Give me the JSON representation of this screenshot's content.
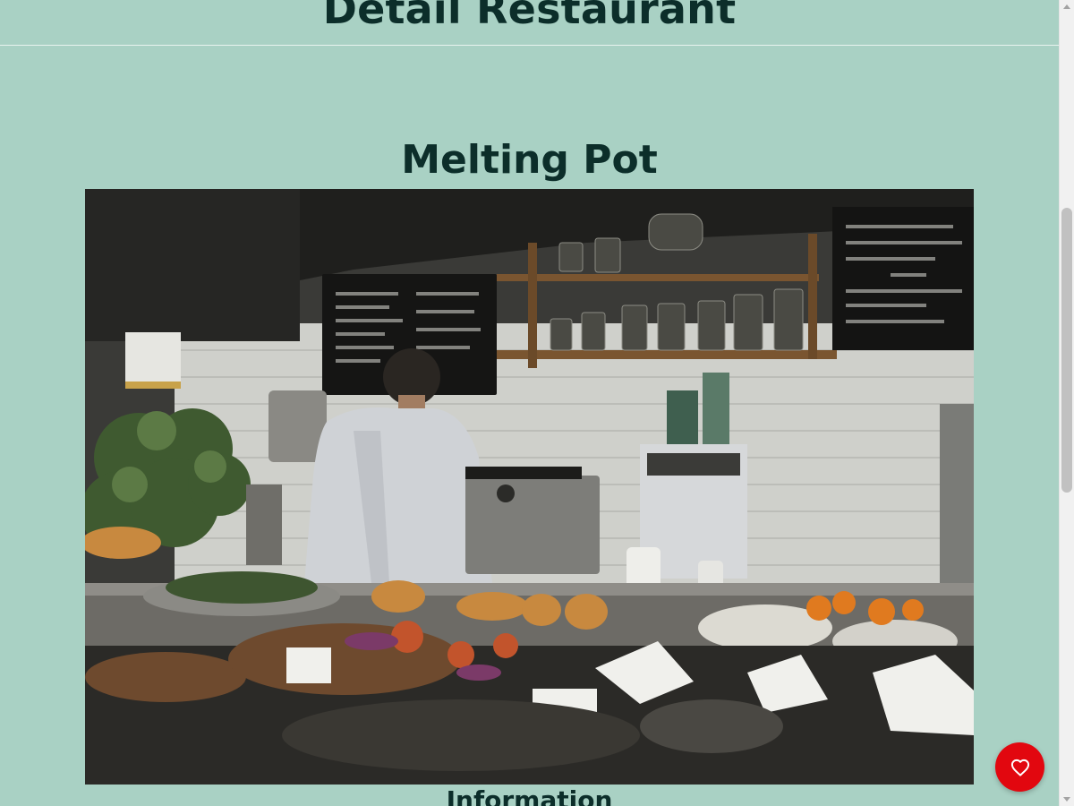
{
  "header": {
    "title": "Detail Restaurant"
  },
  "restaurant": {
    "name": "Melting Pot",
    "photo_icon": "restaurant-photo"
  },
  "sections": {
    "information_heading": "Information"
  },
  "favorite": {
    "icon": "heart-icon",
    "color": "#e2070f"
  },
  "colors": {
    "background": "#a9d1c4",
    "text": "#0c2e2a"
  }
}
